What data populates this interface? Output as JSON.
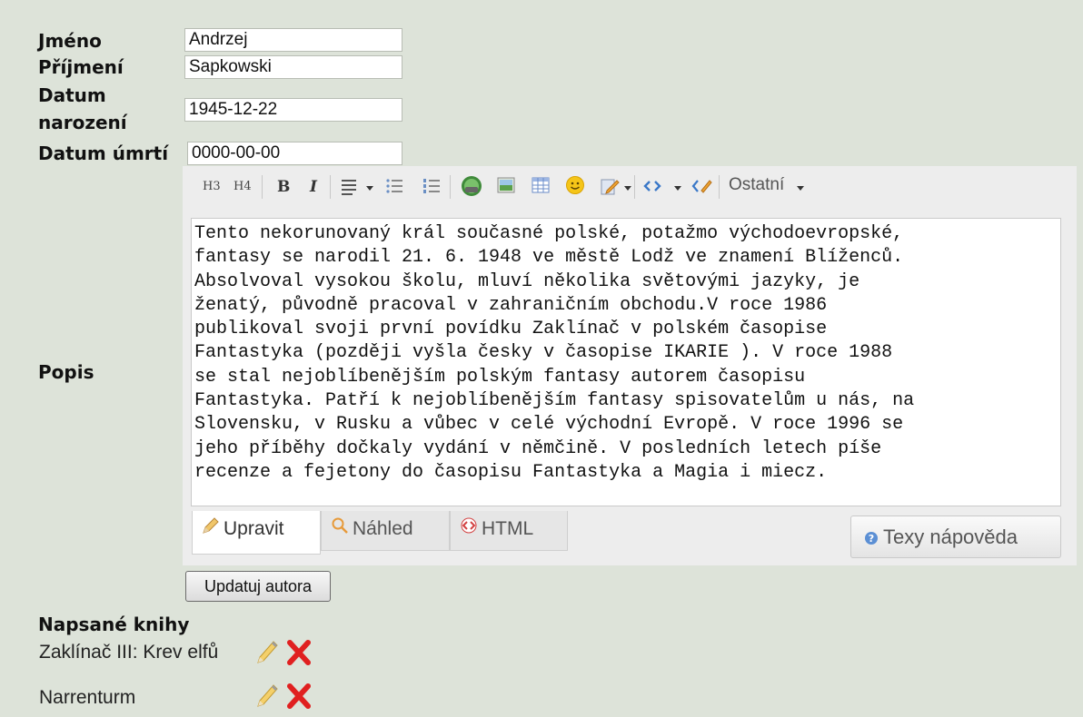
{
  "form": {
    "first_name_label": "Jméno",
    "first_name_value": "Andrzej",
    "last_name_label": "Příjmení",
    "last_name_value": "Sapkowski",
    "birth_label_line1": "Datum",
    "birth_label_line2": "narození",
    "birth_value": "1945-12-22",
    "death_label": "Datum úmrtí",
    "death_value": "0000-00-00",
    "description_label": "Popis"
  },
  "editor": {
    "toolbar": {
      "h3": "H3",
      "h4": "H4",
      "bold": "B",
      "italic": "I",
      "other": "Ostatní"
    },
    "text_lines": [
      "Tento nekorunovaný král současné polské, potažmo východoevropské,",
      "fantasy se narodil 21. 6. 1948 ve městě Lodž ve znamení Blíženců.",
      "Absolvoval vysokou školu, mluví několika světovými jazyky, je",
      "ženatý, původně pracoval v zahraničním obchodu.V roce 1986",
      "publikoval svoji první povídku Zaklínač v polském časopise",
      "Fantastyka (později vyšla česky v časopise IKARIE ). V roce 1988",
      "se stal nejoblíbenějším polským fantasy autorem časopisu",
      "Fantastyka. Patří k nejoblíbenějším fantasy spisovatelům u nás, na",
      "Slovensku, v Rusku a vůbec v celé východní Evropě. V roce 1996 se",
      "jeho příběhy dočkaly vydání v němčině. V posledních letech píše",
      "recenze a fejetony do časopisu Fantastyka a Magia i miecz."
    ],
    "tabs": {
      "edit": "Upravit",
      "preview": "Náhled",
      "html": "HTML"
    },
    "help_button": "Texy nápověda"
  },
  "submit_label": "Updatuj autora",
  "books": {
    "heading": "Napsané knihy",
    "items": [
      {
        "title": "Zaklínač III: Krev elfů"
      },
      {
        "title": "Narrenturm"
      }
    ]
  },
  "colors": {
    "page_bg": "#dde3d9",
    "editor_bg": "#ededed",
    "delete_red": "#e02020",
    "link_blue": "#3a78c8"
  }
}
